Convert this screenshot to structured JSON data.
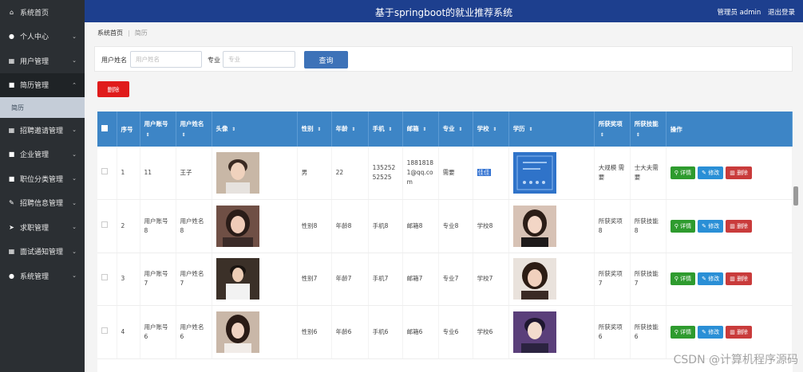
{
  "header": {
    "title": "基于springboot的就业推荐系统",
    "user": "管理员 admin",
    "logout": "退出登录"
  },
  "sidebar": {
    "items": [
      {
        "label": "系统首页",
        "icon": "home-icon",
        "glyph": "⌂",
        "chev": ""
      },
      {
        "label": "个人中心",
        "icon": "user-icon",
        "glyph": "●",
        "chev": "⌄"
      },
      {
        "label": "用户管理",
        "icon": "grid-icon",
        "glyph": "▦",
        "chev": "⌄"
      },
      {
        "label": "简历管理",
        "icon": "resume-icon",
        "glyph": "■",
        "chev": "⌃"
      },
      {
        "label": "招聘邀请管理",
        "icon": "grid-icon",
        "glyph": "▦",
        "chev": "⌄"
      },
      {
        "label": "企业管理",
        "icon": "building-icon",
        "glyph": "■",
        "chev": "⌄"
      },
      {
        "label": "职位分类管理",
        "icon": "tag-icon",
        "glyph": "■",
        "chev": "⌄"
      },
      {
        "label": "招聘信息管理",
        "icon": "pen-icon",
        "glyph": "✎",
        "chev": "⌄"
      },
      {
        "label": "求职管理",
        "icon": "send-icon",
        "glyph": "➤",
        "chev": "⌄"
      },
      {
        "label": "面试通知管理",
        "icon": "grid-icon",
        "glyph": "▦",
        "chev": "⌄"
      },
      {
        "label": "系统管理",
        "icon": "pin-icon",
        "glyph": "●",
        "chev": "⌄"
      }
    ],
    "subitem": "简历"
  },
  "breadcrumb": {
    "home": "系统首页",
    "current": "简历"
  },
  "search": {
    "name_label": "用户姓名",
    "name_placeholder": "用户姓名",
    "major_label": "专业",
    "major_placeholder": "专业",
    "query_button": "查询"
  },
  "delete_button": "删除",
  "table": {
    "headers": [
      "序号",
      "用户账号",
      "用户姓名",
      "头像",
      "性别",
      "年龄",
      "手机",
      "邮箱",
      "专业",
      "学校",
      "学历",
      "所获奖项",
      "所获技能",
      "操作"
    ],
    "sort_glyph": "⇕",
    "rows": [
      {
        "no": "1",
        "account": "11",
        "name": "王子",
        "gender": "男",
        "age": "22",
        "phone": "13525252525",
        "email": "18818181@qq.com",
        "major": "需要",
        "school": "佳佳",
        "award": "大规模 需要",
        "skill": "士大夫需要"
      },
      {
        "no": "2",
        "account": "用户账号8",
        "name": "用户姓名8",
        "gender": "性别8",
        "age": "年龄8",
        "phone": "手机8",
        "email": "邮箱8",
        "major": "专业8",
        "school": "学校8",
        "award": "所获奖项8",
        "skill": "所获技能8"
      },
      {
        "no": "3",
        "account": "用户账号7",
        "name": "用户姓名7",
        "gender": "性别7",
        "age": "年龄7",
        "phone": "手机7",
        "email": "邮箱7",
        "major": "专业7",
        "school": "学校7",
        "award": "所获奖项7",
        "skill": "所获技能7"
      },
      {
        "no": "4",
        "account": "用户账号6",
        "name": "用户姓名6",
        "gender": "性别6",
        "age": "年龄6",
        "phone": "手机6",
        "email": "邮箱6",
        "major": "专业6",
        "school": "学校6",
        "award": "所获奖项6",
        "skill": "所获技能6"
      }
    ],
    "ops": {
      "detail": "详情",
      "edit": "修改",
      "delete": "删除"
    }
  },
  "watermark": "CSDN @计算机程序源码",
  "colors": {
    "sidebar": "#2b2f33",
    "header": "#1d3f8e",
    "table_header": "#3d85c6",
    "delete": "#e01b1b",
    "query": "#3d72b8"
  }
}
